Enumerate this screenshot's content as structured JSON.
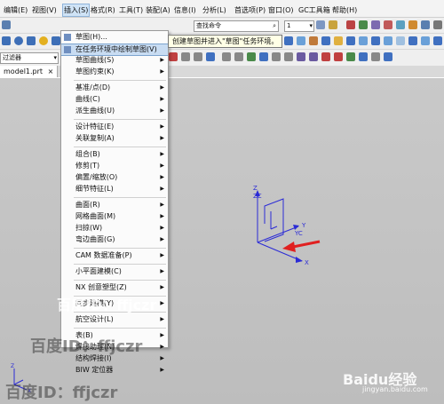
{
  "menubar": {
    "items": [
      "编辑(E)",
      "视图(V)",
      "插入(S)",
      "格式(R)",
      "工具(T)",
      "装配(A)",
      "信息(I)",
      "分析(L)",
      "首选项(P)",
      "窗口(O)",
      "GC工具箱",
      "帮助(H)"
    ],
    "active_index": 2
  },
  "toolbar": {
    "command_search_value": "查找命令",
    "layer_value": "1",
    "filter_label": "过滤器"
  },
  "tab": {
    "label": "model1.prt"
  },
  "insert_menu": {
    "items": [
      {
        "label": "草图(H)...",
        "arrow": false,
        "icon": "sketch-icon"
      },
      {
        "label": "在任务环境中绘制草图(V)",
        "arrow": false,
        "icon": "sketch-task-icon",
        "highlight": true
      },
      {
        "label": "草图曲线(S)",
        "arrow": true
      },
      {
        "label": "草图约束(K)",
        "arrow": true
      },
      {
        "sep": true
      },
      {
        "label": "基准/点(D)",
        "arrow": true
      },
      {
        "label": "曲线(C)",
        "arrow": true
      },
      {
        "label": "派生曲线(U)",
        "arrow": true
      },
      {
        "sep": true
      },
      {
        "label": "设计特征(E)",
        "arrow": true
      },
      {
        "label": "关联复制(A)",
        "arrow": true
      },
      {
        "sep": true
      },
      {
        "label": "组合(B)",
        "arrow": true
      },
      {
        "label": "修剪(T)",
        "arrow": true
      },
      {
        "label": "偏置/缩放(O)",
        "arrow": true
      },
      {
        "label": "细节特征(L)",
        "arrow": true
      },
      {
        "sep": true
      },
      {
        "label": "曲面(R)",
        "arrow": true
      },
      {
        "label": "网格曲面(M)",
        "arrow": true
      },
      {
        "label": "扫掠(W)",
        "arrow": true
      },
      {
        "label": "弯边曲面(G)",
        "arrow": true
      },
      {
        "sep": true
      },
      {
        "label": "CAM 数据准备(P)",
        "arrow": true
      },
      {
        "sep": true
      },
      {
        "label": "小平面建模(C)",
        "arrow": true
      },
      {
        "sep": true
      },
      {
        "label": "NX 创意塑型(Z)",
        "arrow": true
      },
      {
        "sep": true
      },
      {
        "label": "同步建模(Y)",
        "arrow": true
      },
      {
        "sep": true
      },
      {
        "label": "航空设计(L)",
        "arrow": true
      },
      {
        "sep": true
      },
      {
        "label": "表(B)",
        "arrow": true
      },
      {
        "label": "焊接助理(N)",
        "arrow": true
      },
      {
        "label": "结构焊接(I)",
        "arrow": true
      },
      {
        "label": "BIW 定位器",
        "arrow": true
      }
    ]
  },
  "tooltip": {
    "text": "创建草图并进入\"草图\"任务环境。"
  },
  "axes": {
    "x": "X",
    "y": "Y",
    "z": "Z",
    "zc": "ZC",
    "yc": "YC"
  },
  "watermarks": [
    "百度ID：ffjczr",
    "百度ID：ffjczr",
    "百度ID：ffjczr",
    "Baidu经验",
    "jingyan.baidu.com"
  ],
  "colors": {
    "axis_blue": "#2b2bd6",
    "arrow_red": "#e02020",
    "menu_highlight": "#c8dcf2",
    "viewport": "#c4c4c4"
  }
}
